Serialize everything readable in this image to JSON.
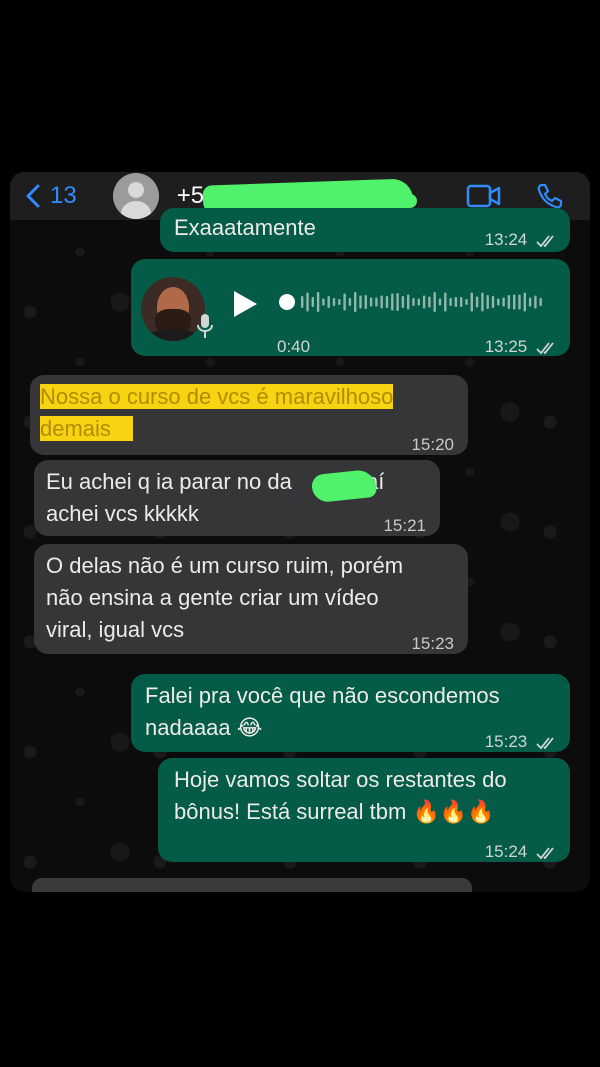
{
  "header": {
    "back_count": "13",
    "contact_visible": "+5",
    "video_icon": "video-call-icon",
    "phone_icon": "phone-call-icon"
  },
  "colors": {
    "outgoing_bubble": "#045b47",
    "incoming_bubble": "#363638",
    "ios_blue": "#2f8cff",
    "highlight": "#f7d312"
  },
  "messages": [
    {
      "direction": "out",
      "text": "Exaaatamente",
      "time": "13:24",
      "status": "read"
    },
    {
      "direction": "out",
      "type": "voice",
      "duration": "0:40",
      "time": "13:25",
      "status": "read"
    },
    {
      "direction": "in",
      "line1": "Nossa o curso de vcs é maravilhoso",
      "line2": "demais",
      "time": "15:20"
    },
    {
      "direction": "in",
      "line1": "Eu achei q ia parar no da",
      "line1_end": ", aí",
      "line2": "achei vcs kkkkk",
      "time": "15:21"
    },
    {
      "direction": "in",
      "line1": "O delas não é um curso ruim, porém",
      "line2": "não ensina a gente criar um vídeo",
      "line3": "viral, igual vcs",
      "time": "15:23"
    },
    {
      "direction": "out",
      "line1": "Falei pra você que não escondemos",
      "line2": "nadaaaa 😂",
      "time": "15:23",
      "status": "read"
    },
    {
      "direction": "out",
      "line1": "Hoje vamos soltar os restantes do",
      "line2": "bônus! Está surreal tbm 🔥🔥🔥",
      "time": "15:24",
      "status": "read"
    }
  ]
}
